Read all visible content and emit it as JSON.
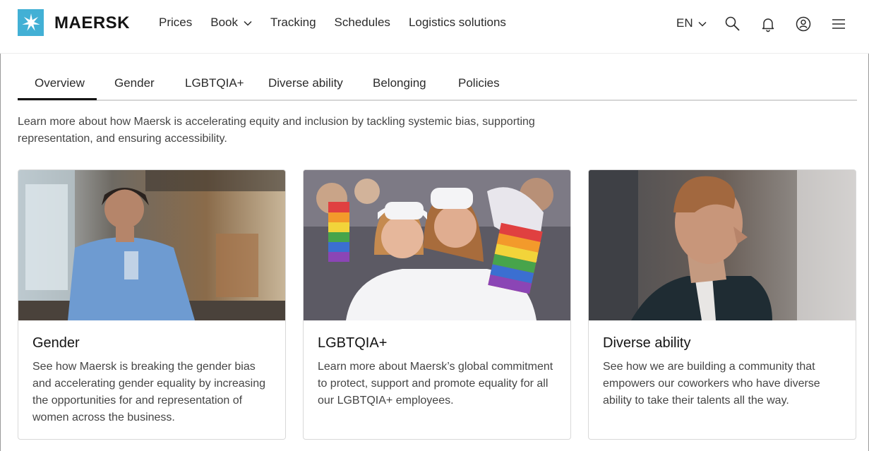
{
  "brand": {
    "name": "MAERSK",
    "logo_color": "#42b0d5"
  },
  "nav": {
    "items": [
      {
        "label": "Prices"
      },
      {
        "label": "Book"
      },
      {
        "label": "Tracking"
      },
      {
        "label": "Schedules"
      },
      {
        "label": "Logistics solutions"
      }
    ],
    "language": "EN",
    "icons": [
      "search-icon",
      "bell-icon",
      "user-icon",
      "menu-icon"
    ]
  },
  "tabs": [
    {
      "label": "Overview",
      "active": true
    },
    {
      "label": "Gender"
    },
    {
      "label": "LGBTQIA+"
    },
    {
      "label": "Diverse ability"
    },
    {
      "label": "Belonging"
    },
    {
      "label": "Policies"
    }
  ],
  "intro": "Learn more about how Maersk is accelerating equity and inclusion by tackling systemic bias, supporting representation, and ensuring accessibility.",
  "cards": [
    {
      "title": "Gender",
      "description": "See how Maersk is breaking the gender bias and accelerating gender equality by increasing the opportunities for and representation of women across the business."
    },
    {
      "title": "LGBTQIA+",
      "description": "Learn more about Maersk’s global commitment to protect, support and promote equality for all our LGBTQIA+ employees."
    },
    {
      "title": "Diverse ability",
      "description": "See how we are building a community that empowers our coworkers who have diverse ability to take their talents all the way."
    }
  ],
  "colors": {
    "accent": "#42b0d5",
    "text": "#141414",
    "muted": "#454545"
  }
}
